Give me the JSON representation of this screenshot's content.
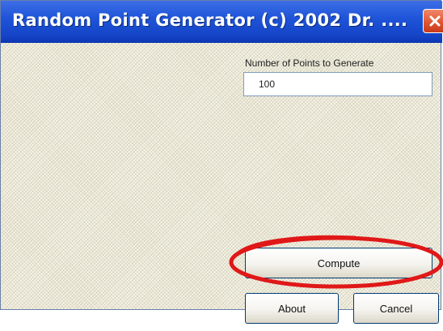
{
  "window": {
    "title": "Random Point Generator  (c) 2002 Dr. ...."
  },
  "form": {
    "points_label": "Number of Points to Generate",
    "points_value": "100"
  },
  "buttons": {
    "compute_label": "Compute",
    "about_label": "About",
    "cancel_label": "Cancel"
  },
  "colors": {
    "titlebar": "#1f55d9",
    "close_button": "#e0522f",
    "highlight": "#e01818"
  },
  "icons": {
    "close": "close-icon"
  }
}
